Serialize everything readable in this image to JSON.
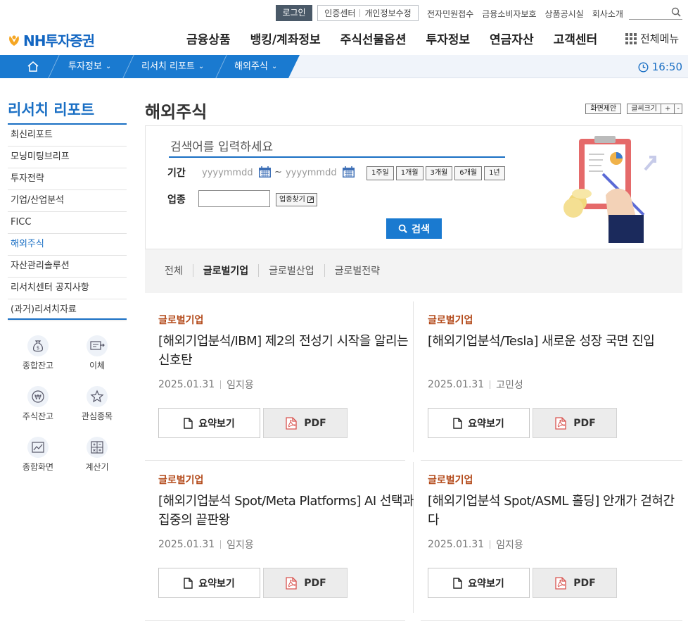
{
  "util": {
    "login": "로그인",
    "cert_center": "인증센터",
    "privacy_edit": "개인정보수정",
    "links": [
      "전자민원접수",
      "금융소비자보호",
      "상품공시실",
      "회사소개"
    ]
  },
  "logo": {
    "text": "NH투자증권"
  },
  "gnb": [
    "금융상품",
    "뱅킹/계좌정보",
    "주식선물옵션",
    "투자정보",
    "연금자산",
    "고객센터"
  ],
  "all_menu": "전체메뉴",
  "breadcrumb": {
    "items": [
      "투자정보",
      "리서치 리포트",
      "해외주식"
    ],
    "time": "16:50"
  },
  "sidebar": {
    "title": "리서치 리포트",
    "items": [
      "최신리포트",
      "모닝미팅브리프",
      "투자전략",
      "기업/산업분석",
      "FICC",
      "해외주식",
      "자산관리솔루션",
      "리서치센터 공지사항",
      "(과거)리서치자료"
    ],
    "active_index": 5,
    "quick": [
      "종합잔고",
      "이체",
      "주식잔고",
      "관심종목",
      "종합화면",
      "계산기"
    ]
  },
  "page": {
    "title": "해외주식",
    "suggest": "화면제안",
    "font_size": "글씨크기",
    "plus": "+",
    "minus": "-"
  },
  "search": {
    "placeholder": "검색어를 입력하세요",
    "period_label": "기간",
    "date_from": "yyyymmdd",
    "date_sep": "~",
    "date_to": "yyyymmdd",
    "periods": [
      "1주일",
      "1개월",
      "3개월",
      "6개월",
      "1년"
    ],
    "industry_label": "업종",
    "industry_button": "업종찾기",
    "submit": "검색"
  },
  "categories": {
    "tabs": [
      "전체",
      "글로벌기업",
      "글로벌산업",
      "글로벌전략"
    ],
    "active_index": 1
  },
  "reports": [
    {
      "category": "글로벌기업",
      "title": "[해외기업분석/IBM] 제2의 전성기 시작을 알리는 신호탄",
      "date": "2025.01.31",
      "author": "임지용",
      "summary": "요약보기",
      "pdf": "PDF"
    },
    {
      "category": "글로벌기업",
      "title": "[해외기업분석/Tesla] 새로운 성장 국면 진입",
      "date": "2025.01.31",
      "author": "고민성",
      "summary": "요약보기",
      "pdf": "PDF"
    },
    {
      "category": "글로벌기업",
      "title": "[해외기업분석 Spot/Meta Platforms] AI 선택과 집중의 끝판왕",
      "date": "2025.01.31",
      "author": "임지용",
      "summary": "요약보기",
      "pdf": "PDF"
    },
    {
      "category": "글로벌기업",
      "title": "[해외기업분석 Spot/ASML 홀딩] 안개가 걷혀간다",
      "date": "2025.01.31",
      "author": "임지용",
      "summary": "요약보기",
      "pdf": "PDF"
    }
  ],
  "colors": {
    "brand_blue": "#1a7ad0",
    "category_text": "#b34a1a",
    "active_nav": "#1a6fc4"
  }
}
